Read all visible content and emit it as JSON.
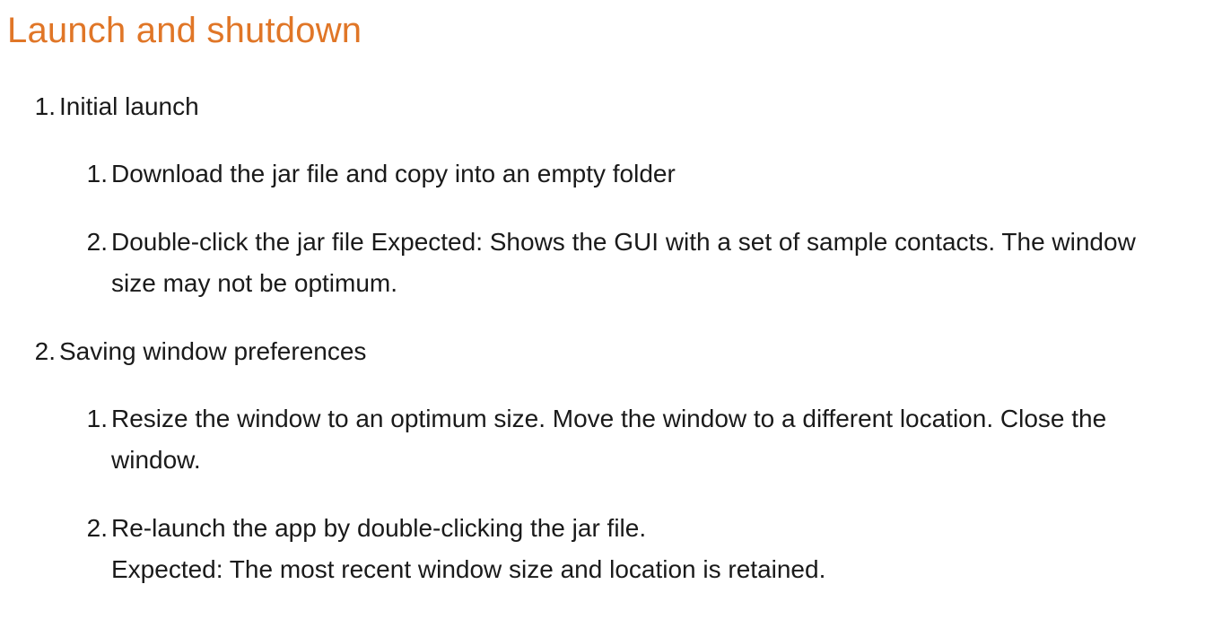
{
  "section": {
    "title": "Launch and shutdown"
  },
  "steps": [
    {
      "number": "1.",
      "label": "Initial launch",
      "substeps": [
        {
          "number": "1.",
          "text": "Download the jar file and copy into an empty folder"
        },
        {
          "number": "2.",
          "text": "Double-click the jar file Expected: Shows the GUI with a set of sample contacts. The window size may not be optimum."
        }
      ]
    },
    {
      "number": "2.",
      "label": "Saving window preferences",
      "substeps": [
        {
          "number": "1.",
          "text": "Resize the window to an optimum size. Move the window to a different location. Close the window."
        },
        {
          "number": "2.",
          "line1": "Re-launch the app by double-clicking the jar file.",
          "line2": "Expected: The most recent window size and location is retained."
        }
      ]
    }
  ]
}
